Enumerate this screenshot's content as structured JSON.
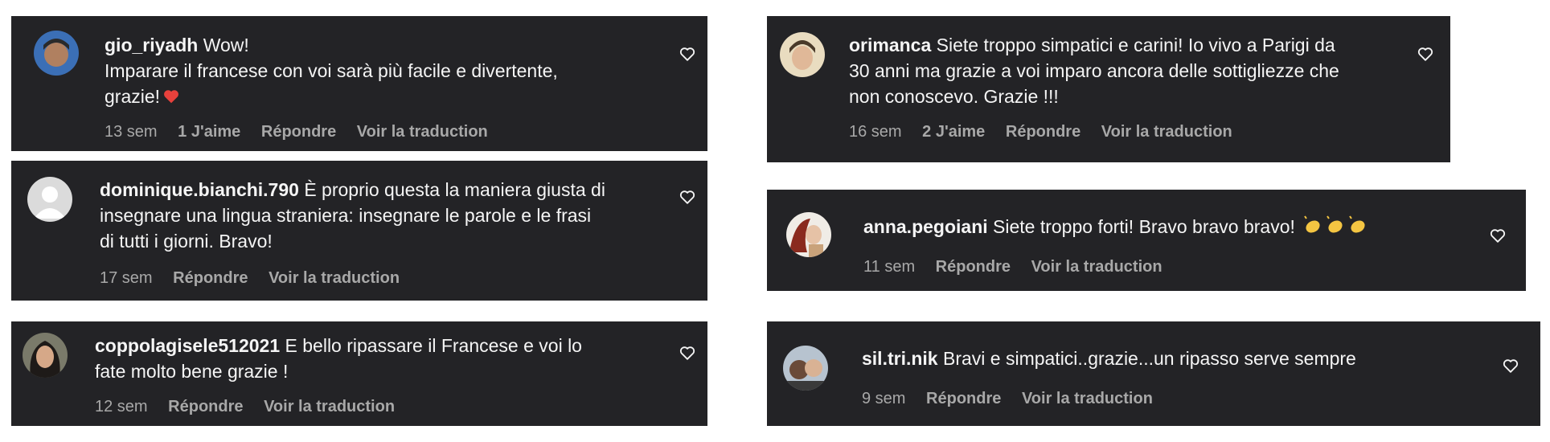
{
  "colors": {
    "card_bg": "#232326",
    "text": "#f5f5f5",
    "meta": "#a8a8a8",
    "heart_red": "#e8413c",
    "clap": "#f4c542"
  },
  "actions": {
    "reply": "Répondre",
    "translate": "Voir la traduction"
  },
  "comments": [
    {
      "username": "gio_riyadh",
      "lines": [
        "Wow!",
        "Imparare il francese con voi sarà più facile e divertente,",
        "grazie!"
      ],
      "time": "13 sem",
      "likes": "1 J'aime"
    },
    {
      "username": "dominique.bianchi.790",
      "lines": [
        "È proprio questa la maniera giusta di",
        "insegnare una lingua straniera: insegnare le parole e le frasi",
        "di tutti i giorni. Bravo!"
      ],
      "time": "17 sem",
      "likes": ""
    },
    {
      "username": "coppolagisele512021",
      "lines": [
        "E bello ripassare il Francese e voi lo",
        "fate molto bene grazie !"
      ],
      "time": "12 sem",
      "likes": ""
    },
    {
      "username": "orimanca",
      "lines": [
        "Siete troppo simpatici e carini! Io vivo a Parigi da",
        "30 anni ma grazie a voi imparo ancora delle sottigliezze che",
        "non conoscevo. Grazie !!!"
      ],
      "time": "16 sem",
      "likes": "2 J'aime"
    },
    {
      "username": "anna.pegoiani",
      "lines": [
        "Siete troppo forti! Bravo bravo bravo!"
      ],
      "time": "11 sem",
      "likes": ""
    },
    {
      "username": "sil.tri.nik",
      "lines": [
        "Bravi e simpatici..grazie...un ripasso serve sempre"
      ],
      "time": "9 sem",
      "likes": ""
    }
  ]
}
